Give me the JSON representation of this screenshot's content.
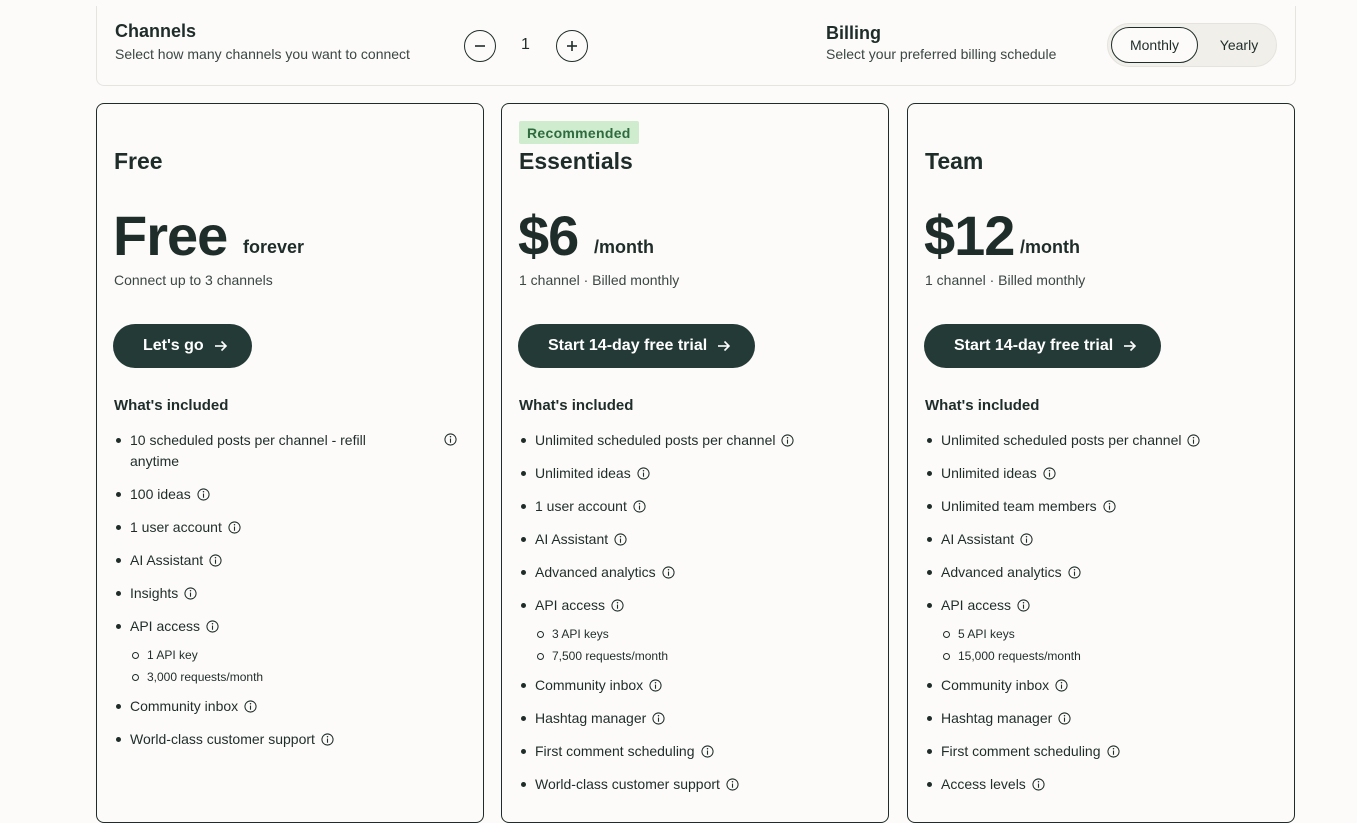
{
  "channels": {
    "title": "Channels",
    "subtitle": "Select how many channels you want to connect",
    "count": "1"
  },
  "billing": {
    "title": "Billing",
    "subtitle": "Select your preferred billing schedule",
    "options": [
      "Monthly",
      "Yearly"
    ],
    "selected": "Monthly"
  },
  "plans": [
    {
      "name": "Free",
      "price": "Free",
      "price_suffix": "forever",
      "note": "Connect up to 3 channels",
      "cta": "Let's go",
      "included_title": "What's included",
      "features": [
        "10 scheduled posts per channel - refill anytime",
        "100 ideas",
        "1 user account",
        "AI Assistant",
        "Insights",
        "API access",
        "Community inbox",
        "World-class customer support"
      ],
      "api_sub": [
        "1 API key",
        "3,000 requests/month"
      ]
    },
    {
      "badge": "Recommended",
      "name": "Essentials",
      "price": "$6",
      "price_suffix": "/month",
      "note": "1 channel · Billed monthly",
      "cta": "Start 14-day free trial",
      "included_title": "What's included",
      "features": [
        "Unlimited scheduled posts per channel",
        "Unlimited ideas",
        "1 user account",
        "AI Assistant",
        "Advanced analytics",
        "API access",
        "Community inbox",
        "Hashtag manager",
        "First comment scheduling",
        "World-class customer support"
      ],
      "api_sub": [
        "3 API keys",
        "7,500 requests/month"
      ]
    },
    {
      "name": "Team",
      "price": "$12",
      "price_suffix": "/month",
      "note": "1 channel · Billed monthly",
      "cta": "Start 14-day free trial",
      "included_title": "What's included",
      "features": [
        "Unlimited scheduled posts per channel",
        "Unlimited ideas",
        "Unlimited team members",
        "AI Assistant",
        "Advanced analytics",
        "API access",
        "Community inbox",
        "Hashtag manager",
        "First comment scheduling",
        "Access levels"
      ],
      "api_sub": [
        "5 API keys",
        "15,000 requests/month"
      ]
    }
  ]
}
